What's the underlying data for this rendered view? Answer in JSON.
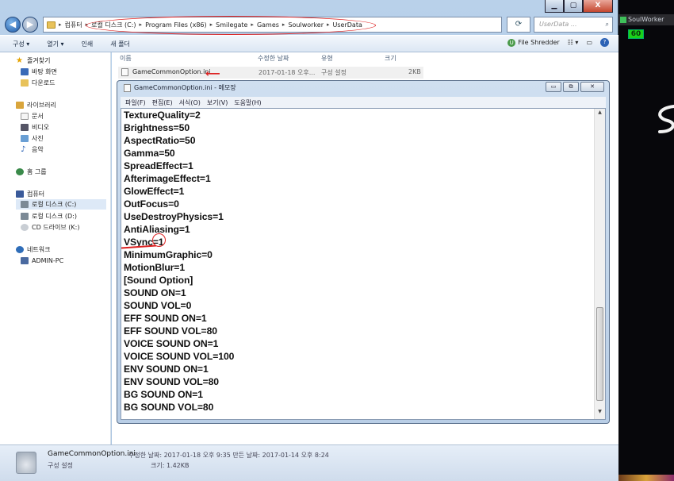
{
  "explorer": {
    "caption_buttons": [
      "▁",
      "▢",
      "X"
    ],
    "address": {
      "crumbs": [
        "컴퓨터",
        "로컬 디스크 (C:)",
        "Program Files (x86)",
        "Smilegate",
        "Games",
        "Soulworker",
        "UserData"
      ],
      "separator": "▸",
      "search_placeholder": "UserData ..."
    },
    "toolbar": {
      "items": [
        "구성 ▾",
        "열기 ▾",
        "인쇄",
        "새 폴더"
      ],
      "file_shredder": "File Shredder"
    },
    "sidebar": {
      "favorites": "즐겨찾기",
      "desktop": "바탕 화면",
      "downloads": "다운로드",
      "libraries": "라이브러리",
      "documents": "문서",
      "videos": "비디오",
      "pictures": "사진",
      "music": "음악",
      "homegroup": "홈 그룹",
      "computer": "컴퓨터",
      "drive_c": "로컬 디스크 (C:)",
      "drive_d": "로컬 디스크 (D:)",
      "drive_k": "CD 드라이브 (K:)",
      "network": "네트워크",
      "admin_pc": "ADMIN-PC"
    },
    "columns": [
      "이름",
      "수정한 날짜",
      "유형",
      "크기"
    ],
    "file": {
      "name": "GameCommonOption.ini",
      "modified": "2017-01-18 오후...",
      "type": "구성 설정",
      "size": "2KB"
    },
    "status": {
      "name": "GameCommonOption.ini",
      "meta": "수정한 날짜: 2017-01-18 오후 9:35   만든 날짜: 2017-01-14 오후 8:24",
      "type": "구성 설정",
      "size": "크기: 1.42KB"
    }
  },
  "notepad": {
    "title": "GameCommonOption.ini - 메모장",
    "menu": [
      "파일(F)",
      "편집(E)",
      "서식(O)",
      "보기(V)",
      "도움말(H)"
    ],
    "lines": [
      "TextureQuality=2",
      "Brightness=50",
      "AspectRatio=50",
      "Gamma=50",
      "SpreadEffect=1",
      "AfterimageEffect=1",
      "GlowEffect=1",
      "OutFocus=0",
      "UseDestroyPhysics=1",
      "AntiAliasing=1",
      "VSync=1",
      "MinimumGraphic=0",
      "MotionBlur=1",
      "[Sound Option]",
      "SOUND ON=1",
      "SOUND VOL=0",
      "EFF SOUND ON=1",
      "EFF SOUND VOL=80",
      "VOICE SOUND ON=1",
      "VOICE SOUND VOL=100",
      "ENV SOUND ON=1",
      "ENV SOUND VOL=80",
      "BG SOUND ON=1",
      "BG SOUND VOL=80"
    ]
  },
  "game": {
    "title": "SoulWorker",
    "fps": "60"
  }
}
